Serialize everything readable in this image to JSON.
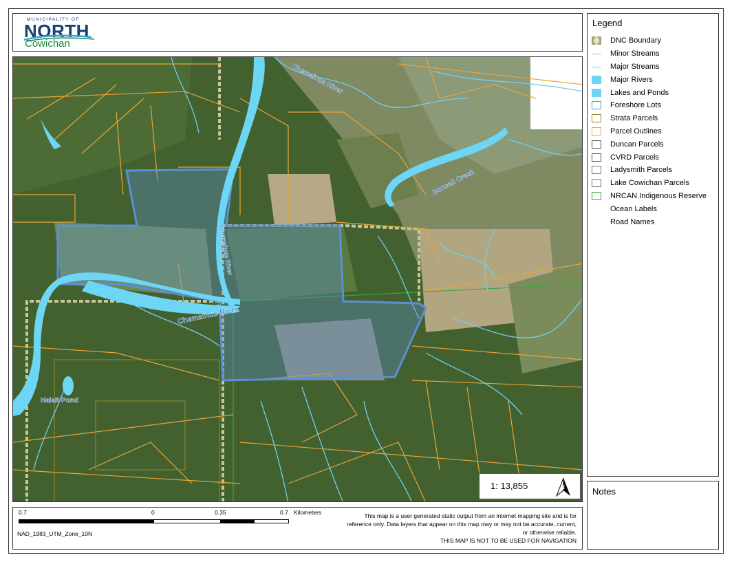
{
  "logo": {
    "top_line": "MUNICIPALITY OF",
    "name_primary": "NORTH",
    "name_secondary": "Cowichan"
  },
  "colors": {
    "dnc_boundary": "#c9c79a",
    "streams": "#6fd0f2",
    "rivers": "#6ed6f5",
    "foreshore": "#5b8fd6",
    "strata": "#9a8a2a",
    "parcel_outlines": "#e8a53a",
    "indigenous": "#3fa53a"
  },
  "map": {
    "labels": {
      "chemainus_river_west": "Chemainus River",
      "chemainus_river_north": "Chemainus River",
      "bonsall_creek": "Bonsall Creek",
      "halalt_pond": "Halalt Pond",
      "river_vertical": "Chemainus River"
    },
    "scale_ratio": "1: 13,855"
  },
  "scalebar": {
    "ticks": [
      "0.7",
      "0",
      "0.35",
      "0.7"
    ],
    "unit": "Kilometers",
    "projection": "NAD_1983_UTM_Zone_10N"
  },
  "disclaimer": {
    "line1": "This map is a user generated static output from an Internet mapping site and is for reference only. Data layers that appear on this map may or may not be accurate, current, or otherwise reliable.",
    "warning": "THIS MAP IS NOT TO BE USED FOR NAVIGATION"
  },
  "legend": {
    "title": "Legend",
    "items": [
      {
        "label": "DNC Boundary",
        "icon": "dashed-boundary-icon"
      },
      {
        "label": "Minor Streams",
        "icon": "thin-line-icon"
      },
      {
        "label": "Major Streams",
        "icon": "line-icon"
      },
      {
        "label": "Major Rivers",
        "icon": "filled-square-icon"
      },
      {
        "label": "Lakes and Ponds",
        "icon": "filled-square-icon"
      },
      {
        "label": "Foreshore Lots",
        "icon": "outline-square-icon"
      },
      {
        "label": "Strata Parcels",
        "icon": "outline-square-icon"
      },
      {
        "label": "Parcel Outlines",
        "icon": "outline-square-icon"
      },
      {
        "label": "Duncan Parcels",
        "icon": "outline-square-icon"
      },
      {
        "label": "CVRD Parcels",
        "icon": "outline-square-icon"
      },
      {
        "label": "Ladysmith Parcels",
        "icon": "outline-square-icon"
      },
      {
        "label": "Lake Cowichan Parcels",
        "icon": "outline-square-icon"
      },
      {
        "label": "NRCAN Indigenous Reserve",
        "icon": "outline-square-icon"
      },
      {
        "label": "Ocean Labels",
        "icon": "none"
      },
      {
        "label": "Road Names",
        "icon": "none"
      }
    ]
  },
  "notes": {
    "title": "Notes"
  }
}
